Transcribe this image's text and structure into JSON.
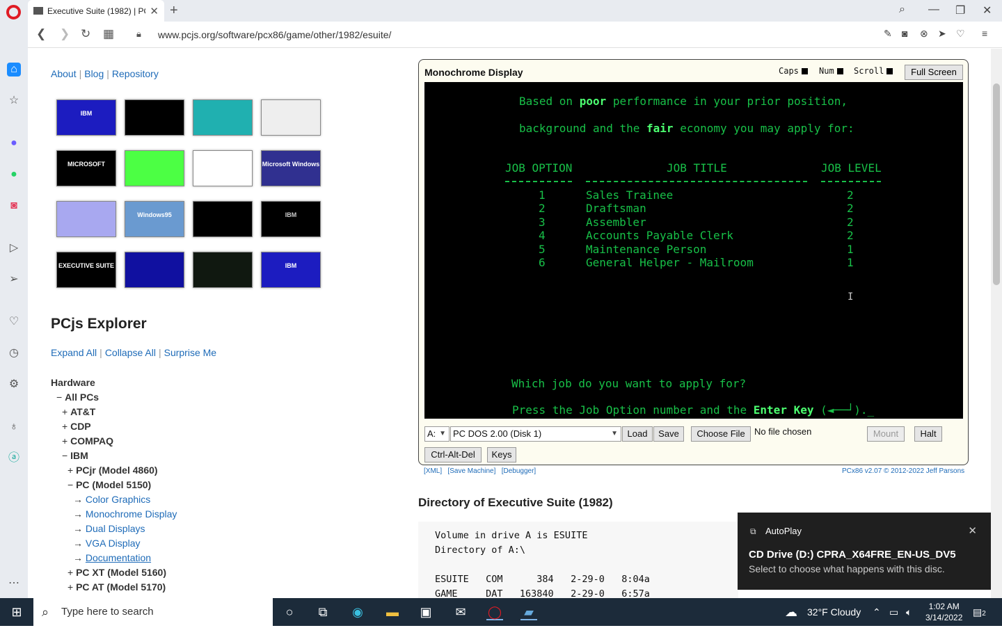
{
  "browser": {
    "tab_title": "Executive Suite (1982) | PC",
    "url": "www.pcjs.org/software/pcx86/game/other/1982/esuite/"
  },
  "page": {
    "top_links": [
      "About",
      "Blog",
      "Repository"
    ],
    "thumbnails": [
      {
        "label": "IBM",
        "bg": "#1c1cc0",
        "fg": "#fff"
      },
      {
        "label": "",
        "bg": "#000",
        "fg": "#0f0"
      },
      {
        "label": "",
        "bg": "#20b0b0",
        "fg": "#fff"
      },
      {
        "label": "",
        "bg": "#eee",
        "fg": "#333"
      },
      {
        "label": "MICROSOFT",
        "bg": "#000",
        "fg": "#fff"
      },
      {
        "label": "",
        "bg": "#4cff44",
        "fg": "#333"
      },
      {
        "label": "",
        "bg": "#fff",
        "fg": "#333"
      },
      {
        "label": "Microsoft Windows",
        "bg": "#303090",
        "fg": "#fff"
      },
      {
        "label": "",
        "bg": "#a8a8f0",
        "fg": "#333"
      },
      {
        "label": "Windows95",
        "bg": "#6a9ad0",
        "fg": "#fff"
      },
      {
        "label": "",
        "bg": "#000",
        "fg": "#ccc"
      },
      {
        "label": "IBM",
        "bg": "#000",
        "fg": "#ccc"
      },
      {
        "label": "EXECUTIVE SUITE",
        "bg": "#000",
        "fg": "#fff"
      },
      {
        "label": "",
        "bg": "#1010a0",
        "fg": "#fff"
      },
      {
        "label": "",
        "bg": "#101810",
        "fg": "#4f4"
      },
      {
        "label": "IBM",
        "bg": "#1c1cc0",
        "fg": "#fff"
      }
    ],
    "explorer_title": "PCjs Explorer",
    "explorer_links": [
      "Expand All",
      "Collapse All",
      "Surprise Me"
    ],
    "tree": [
      {
        "indent": 0,
        "prefix": "",
        "text": "Hardware",
        "bold": true,
        "link": false
      },
      {
        "indent": 1,
        "prefix": "− ",
        "text": "All PCs",
        "bold": true,
        "link": false
      },
      {
        "indent": 2,
        "prefix": "+ ",
        "text": "AT&T",
        "bold": true,
        "link": false
      },
      {
        "indent": 2,
        "prefix": "+ ",
        "text": "CDP",
        "bold": true,
        "link": false
      },
      {
        "indent": 2,
        "prefix": "+ ",
        "text": "COMPAQ",
        "bold": true,
        "link": false
      },
      {
        "indent": 2,
        "prefix": "− ",
        "text": "IBM",
        "bold": true,
        "link": false
      },
      {
        "indent": 3,
        "prefix": "+ ",
        "text": "PCjr (Model 4860)",
        "bold": true,
        "link": false
      },
      {
        "indent": 3,
        "prefix": "− ",
        "text": "PC (Model 5150)",
        "bold": true,
        "link": false
      },
      {
        "indent": 4,
        "prefix": "→ ",
        "text": "Color Graphics",
        "bold": false,
        "link": true
      },
      {
        "indent": 4,
        "prefix": "→ ",
        "text": "Monochrome Display",
        "bold": false,
        "link": true
      },
      {
        "indent": 4,
        "prefix": "→ ",
        "text": "Dual Displays",
        "bold": false,
        "link": true
      },
      {
        "indent": 4,
        "prefix": "→ ",
        "text": "VGA Display",
        "bold": false,
        "link": true
      },
      {
        "indent": 4,
        "prefix": "→ ",
        "text": "Documentation",
        "bold": false,
        "link": true
      },
      {
        "indent": 3,
        "prefix": "+ ",
        "text": "PC XT (Model 5160)",
        "bold": true,
        "link": false
      },
      {
        "indent": 3,
        "prefix": "+ ",
        "text": "PC AT (Model 5170)",
        "bold": true,
        "link": false
      }
    ]
  },
  "machine": {
    "display_title": "Monochrome Display",
    "indicators": [
      "Caps",
      "Num",
      "Scroll"
    ],
    "fullscreen_label": "Full Screen",
    "screen": {
      "line1a": "Based on ",
      "line1b": "poor",
      "line1c": " performance in your prior position,",
      "line2a": "background and the ",
      "line2b": "fair",
      "line2c": " economy you may apply for:",
      "col1": "JOB OPTION",
      "col2": "JOB TITLE",
      "col3": "JOB LEVEL",
      "jobs": [
        {
          "option": "1",
          "title": "Sales Trainee",
          "level": "2"
        },
        {
          "option": "2",
          "title": "Draftsman",
          "level": "2"
        },
        {
          "option": "3",
          "title": "Assembler",
          "level": "2"
        },
        {
          "option": "4",
          "title": "Accounts Payable Clerk",
          "level": "2"
        },
        {
          "option": "5",
          "title": "Maintenance Person",
          "level": "1"
        },
        {
          "option": "6",
          "title": "General Helper - Mailroom",
          "level": "1"
        }
      ],
      "question": "Which job do you want to apply for?",
      "prompt_a": "Press the Job Option number and the ",
      "prompt_b": "Enter Key",
      "prompt_c": " (◄──┘)._"
    },
    "drive_select": "A:",
    "disk_select": "PC DOS 2.00 (Disk 1)",
    "load_label": "Load",
    "save_label": "Save",
    "choose_file_label": "Choose File",
    "no_file_text": "No file chosen",
    "mount_label": "Mount",
    "halt_label": "Halt",
    "cad_label": "Ctrl-Alt-Del",
    "keys_label": "Keys",
    "footer_left": "[XML]   [Save Machine]   [Debugger]",
    "footer_right": "PCx86 v2.07 © 2012-2022 Jeff Parsons"
  },
  "directory": {
    "title": "Directory of Executive Suite (1982)",
    "lines": [
      "Volume in drive A is ESUITE",
      "Directory of A:\\",
      "",
      "ESUITE   COM      384   2-29-0   8:04a",
      "GAME     DAT   163840   2-29-0   6:57a"
    ]
  },
  "toast": {
    "app": "AutoPlay",
    "heading": "CD Drive (D:) CPRA_X64FRE_EN-US_DV5",
    "message": "Select to choose what happens with this disc."
  },
  "taskbar": {
    "search_placeholder": "Type here to search",
    "weather": "32°F  Cloudy",
    "time": "1:02 AM",
    "date": "3/14/2022",
    "notif_count": "2"
  }
}
